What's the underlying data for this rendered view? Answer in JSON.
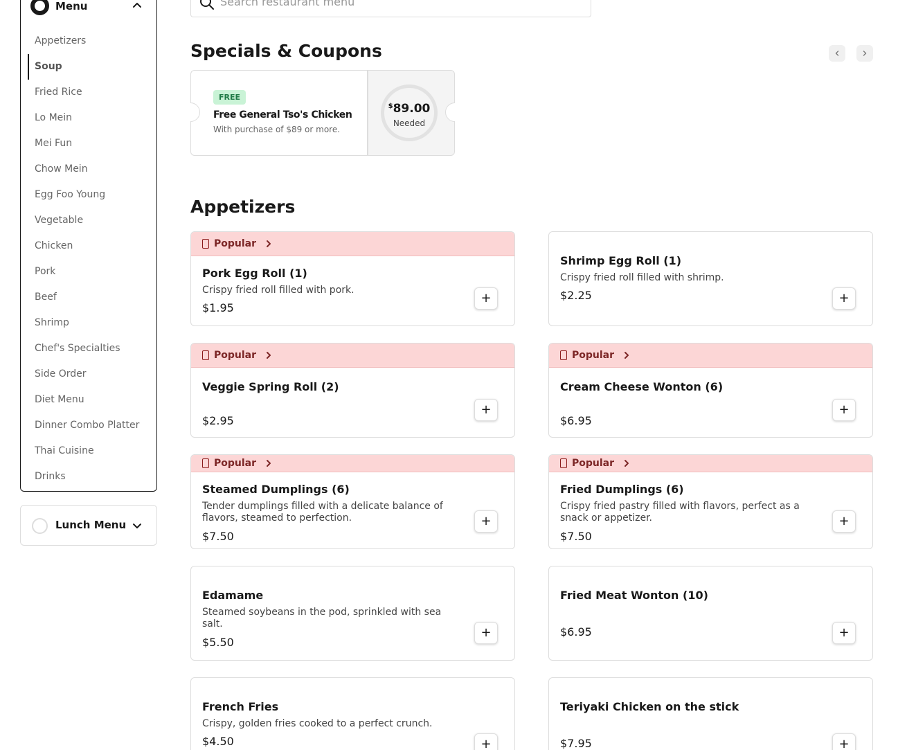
{
  "search": {
    "placeholder": "Search restaurant menu"
  },
  "sidebar": {
    "menu_title": "Menu",
    "categories": [
      {
        "label": "Appetizers"
      },
      {
        "label": "Soup"
      },
      {
        "label": "Fried Rice"
      },
      {
        "label": "Lo Mein"
      },
      {
        "label": "Mei Fun"
      },
      {
        "label": "Chow Mein"
      },
      {
        "label": "Egg Foo Young"
      },
      {
        "label": "Vegetable"
      },
      {
        "label": "Chicken"
      },
      {
        "label": "Pork"
      },
      {
        "label": "Beef"
      },
      {
        "label": "Shrimp"
      },
      {
        "label": "Chef's Specialties"
      },
      {
        "label": "Side Order"
      },
      {
        "label": "Diet Menu"
      },
      {
        "label": "Dinner Combo Platter"
      },
      {
        "label": "Thai Cuisine"
      },
      {
        "label": "Drinks"
      }
    ],
    "active_category": "Soup",
    "lunch_menu_label": "Lunch Menu"
  },
  "specials": {
    "heading": "Specials & Coupons",
    "coupon": {
      "badge": "FREE",
      "title": "Free General Tso's Chicken",
      "subtitle": "With purchase of $89 or more.",
      "currency": "$",
      "amount": "89.00",
      "needed_label": "Needed"
    }
  },
  "appetizers": {
    "heading": "Appetizers",
    "popular_label": "Popular",
    "items": [
      {
        "name": "Pork Egg Roll (1)",
        "description": "Crispy fried roll filled with pork.",
        "price": "$1.95",
        "popular": true
      },
      {
        "name": "Shrimp Egg Roll (1)",
        "description": "Crispy fried roll filled with shrimp.",
        "price": "$2.25",
        "popular": false
      },
      {
        "name": "Veggie Spring Roll (2)",
        "description": "",
        "price": "$2.95",
        "popular": true
      },
      {
        "name": "Cream Cheese Wonton (6)",
        "description": "",
        "price": "$6.95",
        "popular": true
      },
      {
        "name": "Steamed Dumplings (6)",
        "description": "Tender dumplings filled with a delicate balance of flavors, steamed to perfection.",
        "price": "$7.50",
        "popular": true
      },
      {
        "name": "Fried Dumplings (6)",
        "description": "Crispy fried pastry filled with flavors, perfect as a snack or appetizer.",
        "price": "$7.50",
        "popular": true
      },
      {
        "name": "Edamame",
        "description": "Steamed soybeans in the pod, sprinkled with sea salt.",
        "price": "$5.50",
        "popular": false
      },
      {
        "name": "Fried Meat Wonton (10)",
        "description": "",
        "price": "$6.95",
        "popular": false
      },
      {
        "name": "French Fries",
        "description": "Crispy, golden fries cooked to a perfect crunch.",
        "price": "$4.50",
        "popular": false
      },
      {
        "name": "Teriyaki Chicken on the stick",
        "description": "",
        "price": "$7.95",
        "popular": false
      }
    ]
  },
  "icons": {
    "search": "search-icon",
    "ring": "ring-icon",
    "chevron_up": "chevron-up-icon",
    "chevron_down": "chevron-down-icon",
    "chevron_left": "chevron-left-icon",
    "chevron_right": "chevron-right-icon",
    "flame": "flame-icon",
    "plus": "plus-icon"
  },
  "colors": {
    "popular_background": "#fcd6d6",
    "popular_text": "#7c2626",
    "free_badge_background": "#c9f3d6",
    "free_badge_text": "#1f7a45"
  }
}
